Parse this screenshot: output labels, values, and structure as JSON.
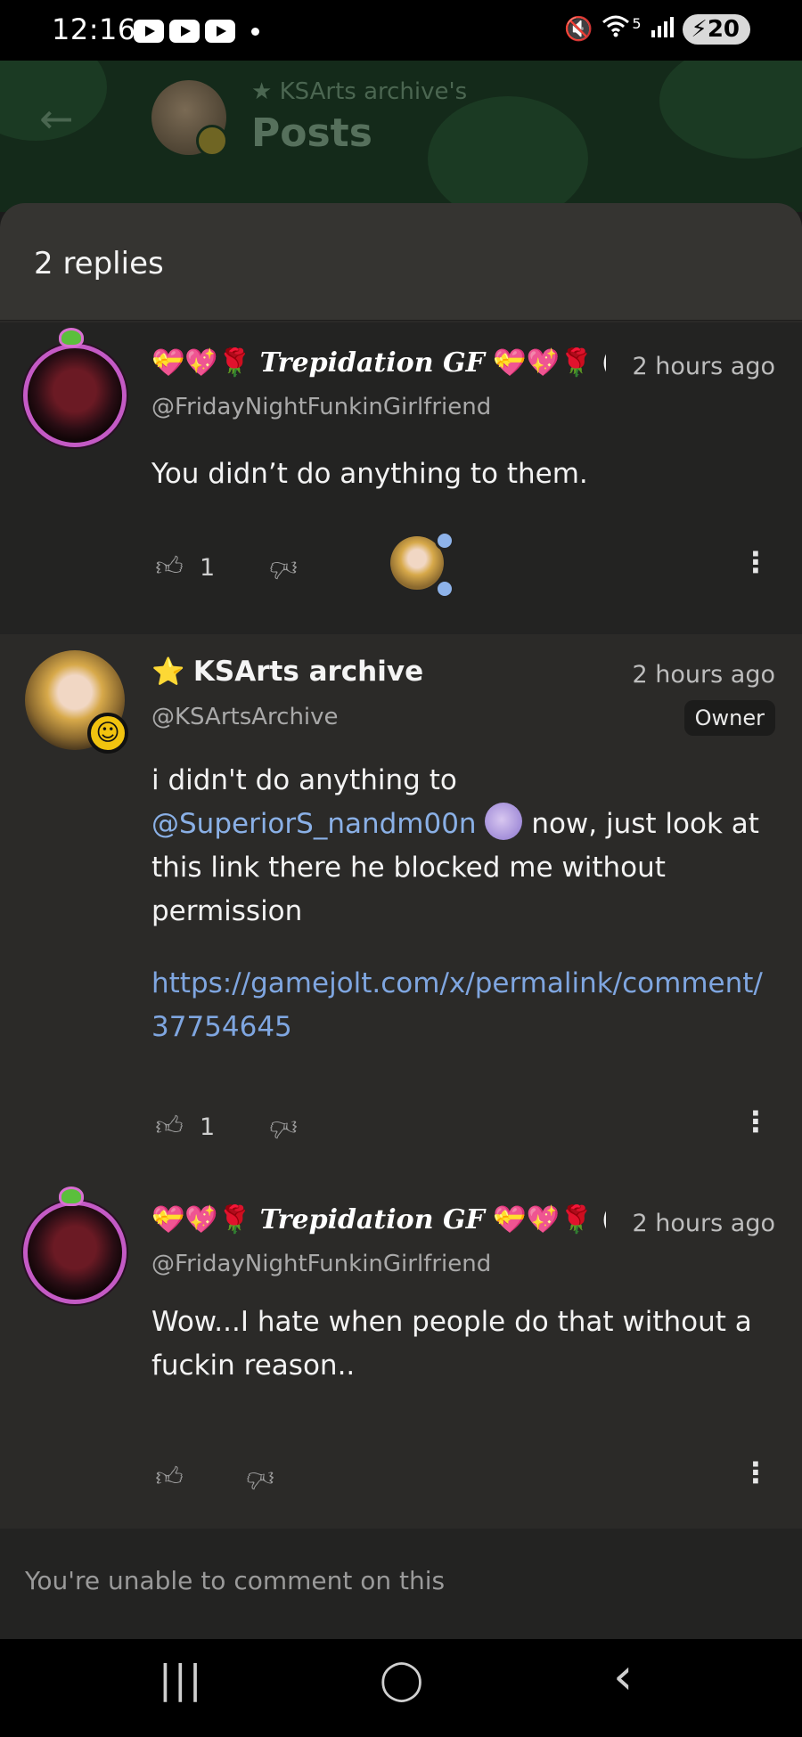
{
  "status_bar": {
    "time": "12:16",
    "battery": "20",
    "signal": "5"
  },
  "header": {
    "small_title": "★ KSArts archive's",
    "title": "Posts"
  },
  "sheet": {
    "replies_count": "2 replies"
  },
  "comments": [
    {
      "name_prefix": "💝💖🌹",
      "name": "Trepidation GF",
      "name_suffix": "💝💖🌹 (",
      "time": "2 hours ago",
      "handle": "@FridayNightFunkinGirlfriend",
      "body": "You didn’t do anything to them.",
      "likes": "1"
    },
    {
      "name_prefix": "⭐",
      "name": "KSArts archive",
      "time": "2 hours ago",
      "handle": "@KSArtsArchive",
      "owner_badge": "Owner",
      "body_part1": "i didn't do anything to",
      "mention": "@SuperiorS_nandm00n",
      "body_part2": "now, just look at this link there he blocked me without permission",
      "link_line1": "https://gamejolt.com/x/permalink/comment/",
      "link_line2": "37754645",
      "likes": "1"
    },
    {
      "name_prefix": "💝💖🌹",
      "name": "Trepidation GF",
      "name_suffix": "💝💖🌹 (",
      "time": "2 hours ago",
      "handle": "@FridayNightFunkinGirlfriend",
      "body": "Wow...I hate when people do that without a fuckin reason.."
    }
  ],
  "footer": {
    "notice": "You're unable to comment on this"
  },
  "nav": {
    "recent": "|||",
    "home": "◯",
    "back": "‹"
  }
}
